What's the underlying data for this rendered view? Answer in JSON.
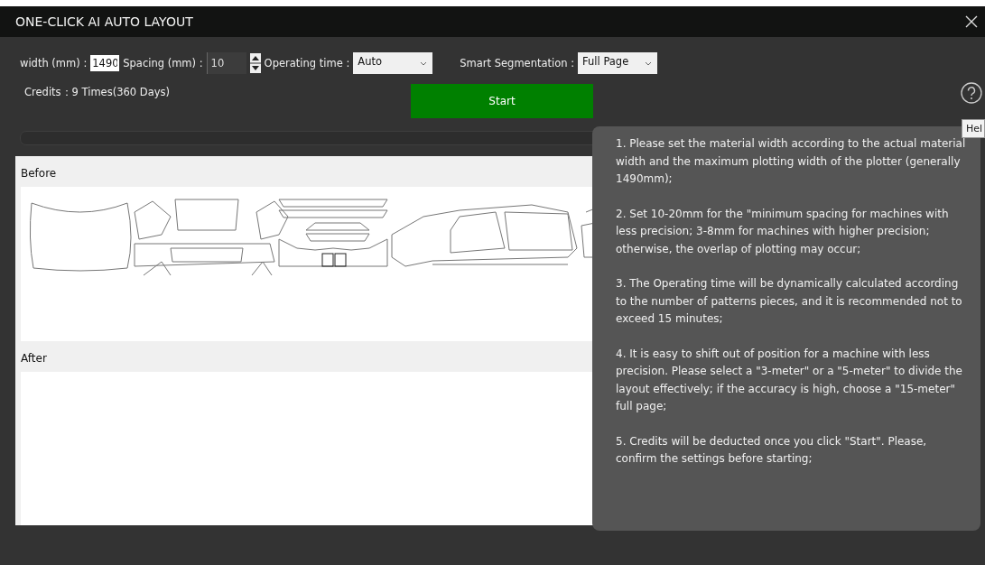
{
  "window": {
    "title": "ONE-CLICK AI AUTO LAYOUT"
  },
  "settings": {
    "width": {
      "label": "width (mm) :",
      "value": "1490"
    },
    "spacing": {
      "label": "Spacing (mm) :",
      "value": "10"
    },
    "operating_time": {
      "label": "Operating time :",
      "value": "Auto"
    },
    "segmentation": {
      "label": "Smart Segmentation :",
      "value": "Full Page"
    }
  },
  "credits": "Credits：9 Times(360 Days)",
  "start_button": "Start",
  "progress": {
    "level": 0
  },
  "panels": [
    {
      "title": "Before"
    },
    {
      "title": "After"
    }
  ],
  "help": {
    "tooltip": "Hel",
    "items": [
      "1. Please set the material width according to the actual material width and the maximum plotting width of the plotter (generally 1490mm);",
      "2. Set 10-20mm for the \"minimum spacing for machines with less precision; 3-8mm for machines with higher precision; otherwise, the overlap of plotting may occur;",
      "3. The Operating time will be dynamically calculated according to the number of patterns pieces, and it is recommended not to exceed 15 minutes;",
      "4. It is easy to shift out of position for a machine with less precision. Please select a \"3-meter\" or a \"5-meter\" to divide the layout effectively; if the accuracy is high, choose a \"15-meter\" full page;",
      "5. Credits will be deducted once you click \"Start\". Please, confirm the settings before starting;"
    ]
  }
}
